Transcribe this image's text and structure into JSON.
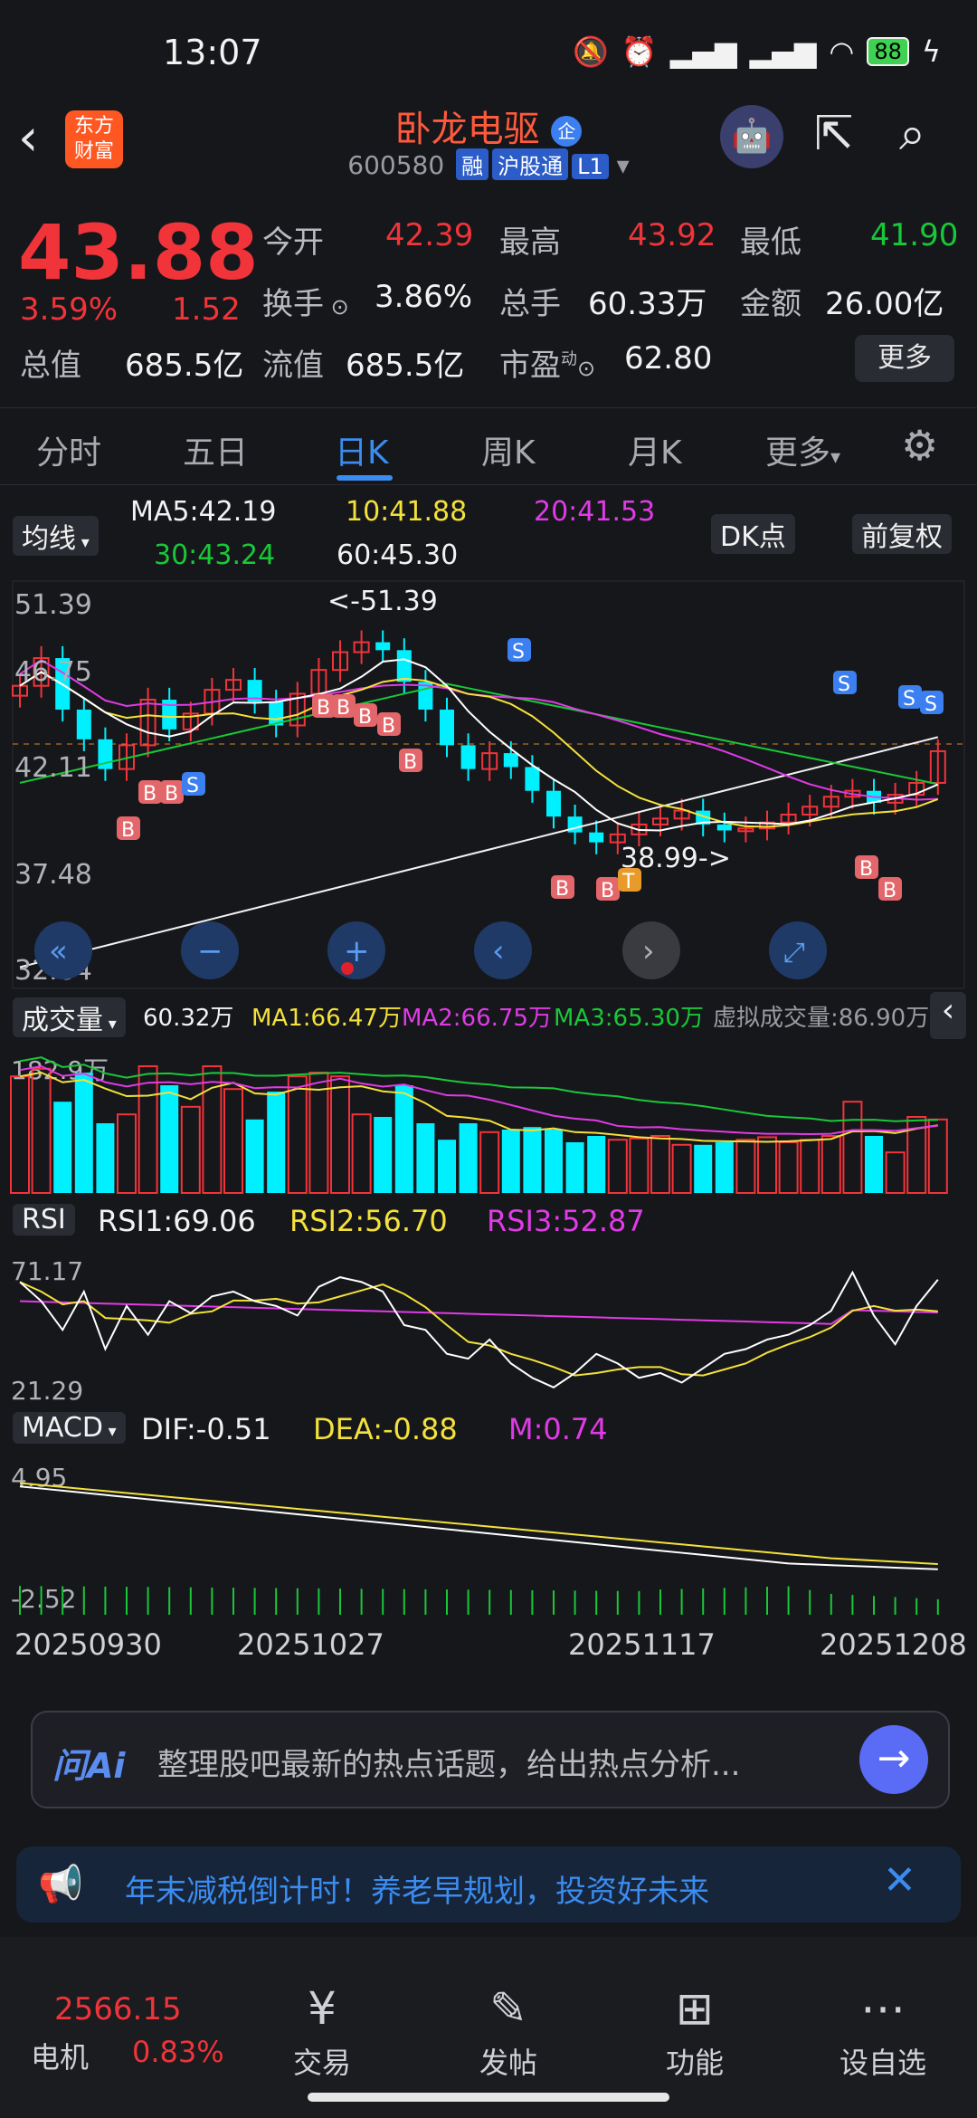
{
  "status_bar": {
    "time": "13:07",
    "battery": "88"
  },
  "header": {
    "logo_line1": "东方",
    "logo_line2": "财富",
    "stock_name": "卧龙电驱",
    "corp_badge": "企",
    "code": "600580",
    "tag1": "融",
    "tag2": "沪股通",
    "tag3": "L1"
  },
  "quote": {
    "price": "43.88",
    "change_pct": "3.59%",
    "change": "1.52",
    "open_label": "今开",
    "open": "42.39",
    "high_label": "最高",
    "high": "43.92",
    "low_label": "最低",
    "low": "41.90",
    "turnover_label": "换手",
    "turnover": "3.86%",
    "volume_label": "总手",
    "volume": "60.33万",
    "amount_label": "金额",
    "amount": "26.00亿",
    "mktcap_label": "总值",
    "mktcap": "685.5亿",
    "float_label": "流值",
    "float": "685.5亿",
    "pe_label": "市盈",
    "pe_sup": "动",
    "pe": "62.80",
    "more": "更多"
  },
  "tabs": [
    "分时",
    "五日",
    "日K",
    "周K",
    "月K",
    "更多"
  ],
  "active_tab": "日K",
  "ma_row": {
    "selector": "均线",
    "ma5": "MA5:42.19",
    "ma10": "10:41.88",
    "ma20": "20:41.53",
    "ma30": "30:43.24",
    "ma60": "60:45.30",
    "dk_button": "DK点",
    "adjust_button": "前复权"
  },
  "kline_chart": {
    "y_labels": [
      "51.39",
      "46.75",
      "42.11",
      "37.48",
      "32.84"
    ],
    "high_note": "<-51.39",
    "low_note": "38.99->",
    "colors": {
      "up": "#f0343a",
      "down": "#00f0ff",
      "ma5": "#ffffff",
      "ma10": "#f4e13b",
      "ma20": "#e03be6",
      "ma30": "#19c838",
      "ma60": "#f2f2f2"
    }
  },
  "volume_row": {
    "selector": "成交量",
    "vol": "60.32万",
    "ma1": "MA1:66.47万",
    "ma2": "MA2:66.75万",
    "ma3": "MA3:65.30万",
    "virtual": "虚拟成交量:86.90万",
    "y_label": "182.9万"
  },
  "rsi_row": {
    "selector": "RSI",
    "rsi1": "RSI1:69.06",
    "rsi2": "RSI2:56.70",
    "rsi3": "RSI3:52.87",
    "y_top": "71.17",
    "y_bottom": "21.29"
  },
  "macd_row": {
    "selector": "MACD",
    "dif": "DIF:-0.51",
    "dea": "DEA:-0.88",
    "m": "M:0.74",
    "y_top": "4.95",
    "y_bottom": "-2.52"
  },
  "x_dates": [
    "20250930",
    "20251027",
    "20251117",
    "20251208"
  ],
  "ai_box": {
    "label": "问Ai",
    "text": "整理股吧最新的热点话题，给出热点分析..."
  },
  "notice": {
    "text": "年末减税倒计时！养老早规划，投资好未来"
  },
  "bottom_nav": {
    "index_value": "2566.15",
    "index_name": "电机",
    "index_change": "0.83%",
    "trade": "交易",
    "post": "发帖",
    "features": "功能",
    "watchlist": "设自选"
  }
}
